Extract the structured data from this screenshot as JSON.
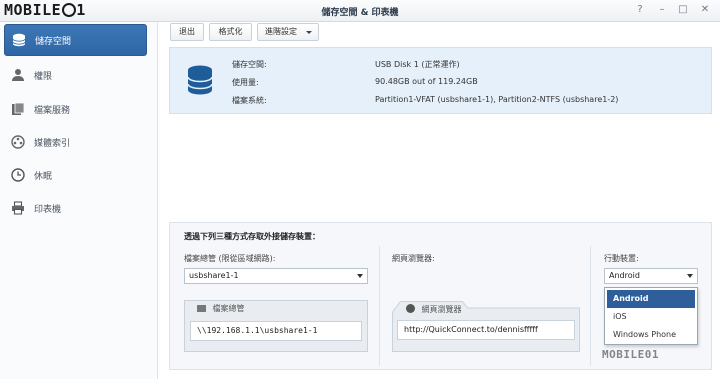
{
  "watermark": "MOBILE01",
  "window": {
    "title": "儲存空間 & 印表機",
    "help_icon": "question-icon",
    "minimize_icon": "minimize-icon",
    "maximize_icon": "maximize-icon",
    "close_icon": "close-icon"
  },
  "sidebar": {
    "items": [
      {
        "label": "儲存空間",
        "icon": "database-icon",
        "active": true
      },
      {
        "label": "權限",
        "icon": "user-icon",
        "active": false
      },
      {
        "label": "檔案服務",
        "icon": "file-service-icon",
        "active": false
      },
      {
        "label": "媒體索引",
        "icon": "media-icon",
        "active": false
      },
      {
        "label": "休眠",
        "icon": "clock-icon",
        "active": false
      },
      {
        "label": "印表機",
        "icon": "printer-icon",
        "active": false
      }
    ]
  },
  "toolbar": {
    "eject_label": "退出",
    "format_label": "格式化",
    "advanced_label": "進階設定"
  },
  "storage_info": {
    "icon": "database-icon",
    "rows": [
      {
        "label": "儲存空間:",
        "value": "USB Disk 1 (正常運作)"
      },
      {
        "label": "使用量:",
        "value": "90.48GB out of 119.24GB"
      },
      {
        "label": "檔案系統:",
        "value": "Partition1-VFAT (usbshare1-1), Partition2-NTFS (usbshare1-2)"
      }
    ]
  },
  "access": {
    "title": "透過下列三種方式存取外接儲存裝置：",
    "file_browser": {
      "label": "檔案總管 (限從區域網路):",
      "selected": "usbshare1-1",
      "card_title": "檔案總管",
      "path": "\\\\192.168.1.1\\usbshare1-1"
    },
    "web_browser": {
      "label": "網頁瀏覽器:",
      "card_title": "網頁瀏覽器",
      "url": "http://QuickConnect.to/dennisfffff"
    },
    "mobile": {
      "label": "行動裝置:",
      "selected": "Android",
      "options": [
        "Android",
        "iOS",
        "Windows Phone"
      ]
    }
  },
  "colors": {
    "accent": "#2f67a5",
    "info_bg": "#e6f0fa",
    "dropdown_selected": "#2e5f9a"
  }
}
